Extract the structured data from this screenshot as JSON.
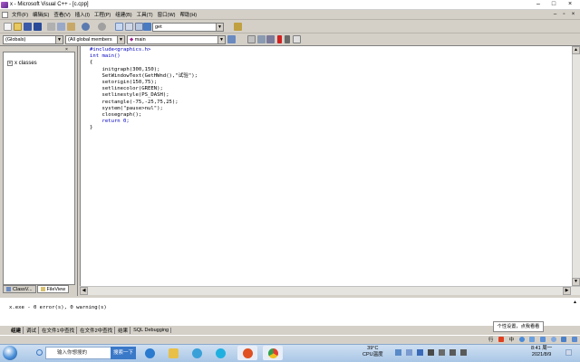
{
  "window": {
    "title": "x - Microsoft Visual C++ - [c.cpp]",
    "min": "–",
    "max": "□",
    "close": "×"
  },
  "menu": {
    "items": [
      "文件(F)",
      "编辑(E)",
      "查看(V)",
      "插入(I)",
      "工程(P)",
      "组建(B)",
      "工具(T)",
      "窗口(W)",
      "帮助(H)"
    ],
    "child_controls": [
      "–",
      "▫",
      "×"
    ]
  },
  "toolbar": {
    "find_combo_value": "get"
  },
  "wizardbar": {
    "class_combo": "(Globals)",
    "filter_combo": "(All global members",
    "members_combo": "main"
  },
  "workspace": {
    "tree_root": "x classes",
    "tabs": [
      "ClassV...",
      "FileView"
    ]
  },
  "editor": {
    "lines": [
      "#include<graphics.h>",
      "int main()",
      "{",
      "    initgraph(300,150);",
      "    SetWindowText(GetHWnd(),\"试验\");",
      "    setorigin(150,75);",
      "    setlinecolor(GREEN);",
      "    setlinestyle(PS_DASH);",
      "    rectangle(-75,-25,75,25);",
      "    system(\"pause>nul\");",
      "    closegraph();",
      "    return 0;",
      "}"
    ]
  },
  "output": {
    "text": "x.exe - 0 error(s), 0 warning(s)",
    "tabs": [
      "组建",
      "调试",
      "在文件1中查找",
      "在文件2中查找",
      "结果",
      "SQL Debugging"
    ]
  },
  "tooltip": "个性设置，点我看看",
  "ime": {
    "label": "行",
    "mode": "中"
  },
  "taskbar": {
    "search_placeholder": "输入你想搜的",
    "search_button": "搜索一下",
    "weather_temp": "39°C",
    "weather_label": "CPU温度",
    "time": "8:41 周一",
    "date": "2021/8/9"
  },
  "colors": {
    "keyword": "#0000c0",
    "chrome": "#d4d0c8",
    "taskbar": "#bcd3ee"
  }
}
